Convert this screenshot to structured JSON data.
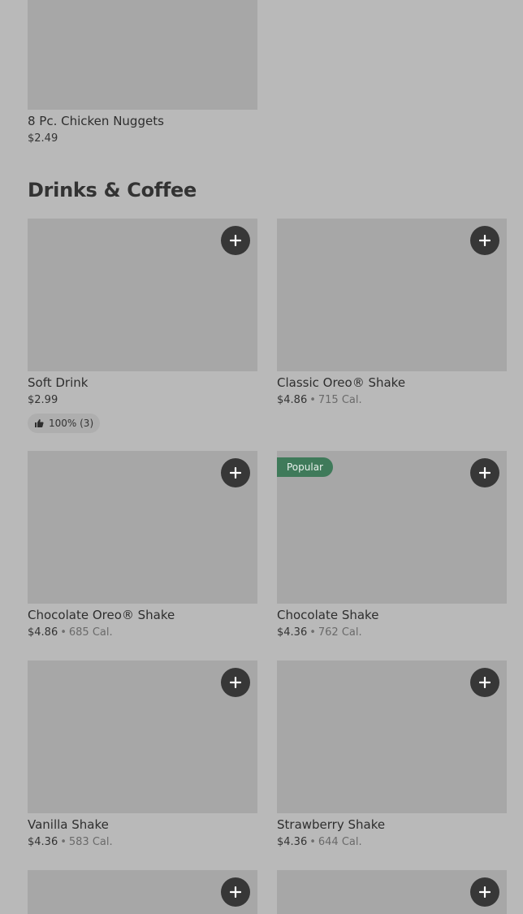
{
  "prev_section": {
    "item": {
      "name": "8 Pc. Chicken Nuggets",
      "price": "$2.49"
    }
  },
  "section": {
    "title": "Drinks & Coffee",
    "items": [
      {
        "name": "Soft Drink",
        "price": "$2.99",
        "rating": "100% (3)"
      },
      {
        "name": "Classic Oreo® Shake",
        "price": "$4.86",
        "separator": "•",
        "calories": "715 Cal."
      },
      {
        "name": "Chocolate Oreo® Shake",
        "price": "$4.86",
        "separator": "•",
        "calories": "685 Cal."
      },
      {
        "name": "Chocolate Shake",
        "price": "$4.36",
        "separator": "•",
        "calories": "762 Cal.",
        "badge": "Popular"
      },
      {
        "name": "Vanilla Shake",
        "price": "$4.36",
        "separator": "•",
        "calories": "583 Cal."
      },
      {
        "name": "Strawberry Shake",
        "price": "$4.36",
        "separator": "•",
        "calories": "644 Cal."
      }
    ]
  },
  "icons": {
    "add": "plus-icon",
    "rating": "thumbs-up-icon"
  },
  "colors": {
    "background": "#b9b9b9",
    "image_placeholder": "#a7a7a7",
    "add_button": "#373737",
    "popular_badge": "#3f7a5a"
  }
}
